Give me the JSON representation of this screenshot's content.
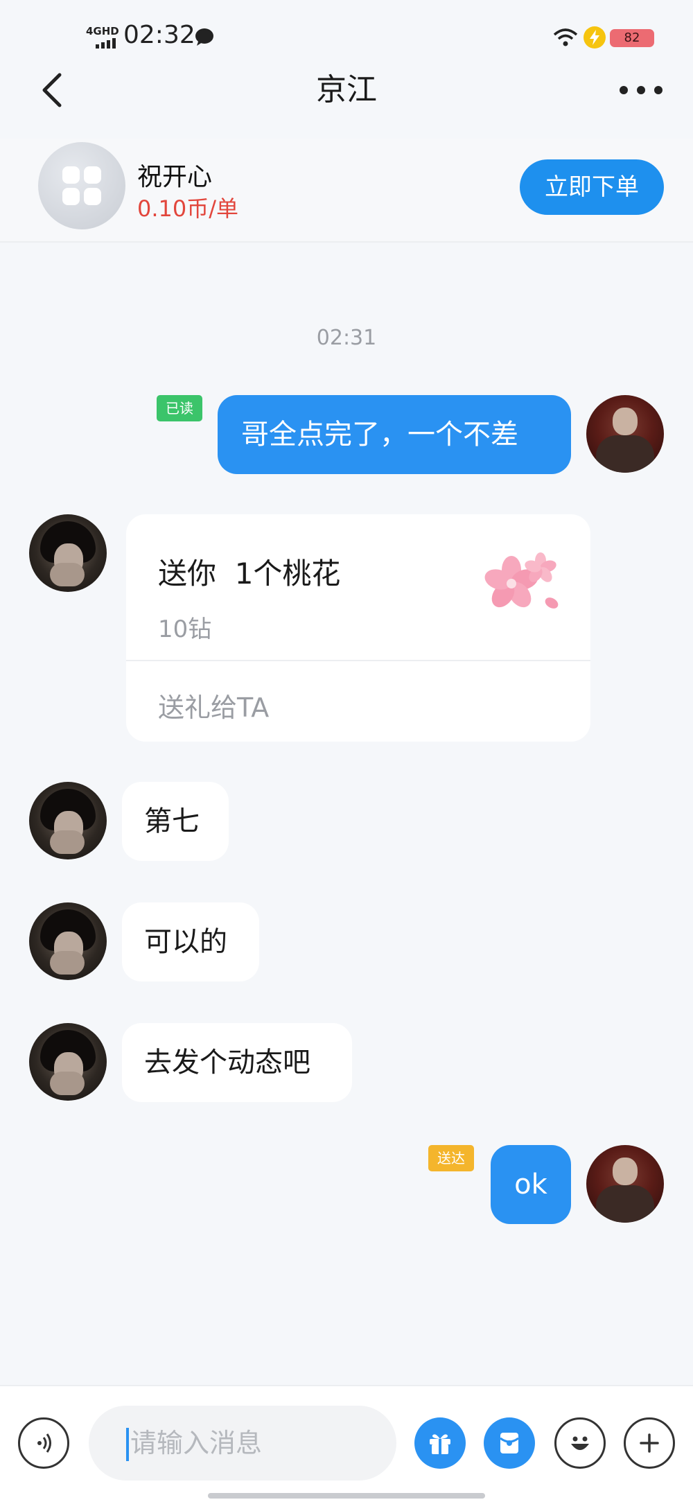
{
  "status_bar": {
    "network": "4GHD",
    "time": "02:32",
    "battery": "82"
  },
  "nav": {
    "title": "京江"
  },
  "service": {
    "name": "祝开心",
    "price": "0.10币/单",
    "order_label": "立即下单"
  },
  "chat": {
    "timestamp": "02:31",
    "messages": [
      {
        "from": "me",
        "text": "哥全点完了，一个不差",
        "status": "已读"
      },
      {
        "from": "them",
        "type": "gift",
        "title": "送你  1个桃花",
        "cost": "10钻",
        "action": "送礼给TA"
      },
      {
        "from": "them",
        "text": "第七"
      },
      {
        "from": "them",
        "text": "可以的"
      },
      {
        "from": "them",
        "text": "去发个动态吧"
      },
      {
        "from": "me",
        "text": "ok",
        "status": "送达"
      }
    ]
  },
  "input": {
    "placeholder": "请输入消息"
  },
  "colors": {
    "accent": "#2a92f2",
    "price": "#e2463c",
    "read_tag": "#3bc46a",
    "sent_tag": "#f4b52c"
  }
}
